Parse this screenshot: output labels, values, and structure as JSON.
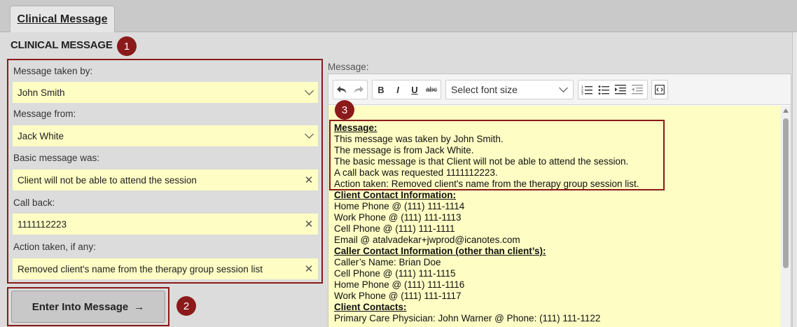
{
  "tab": {
    "label": "Clinical Message"
  },
  "section": {
    "title": "CLINICAL MESSAGE"
  },
  "badges": {
    "one": "1",
    "two": "2",
    "three": "3"
  },
  "form": {
    "taken_by": {
      "label": "Message taken by:",
      "value": "John Smith"
    },
    "from": {
      "label": "Message from:",
      "value": "Jack White"
    },
    "basic": {
      "label": "Basic message was:",
      "value": "Client will not be able to attend the session"
    },
    "callback": {
      "label": "Call back:",
      "value": "1111112223"
    },
    "action": {
      "label": "Action taken, if any:",
      "value": "Removed client's name from the therapy group session list"
    }
  },
  "enter_button": {
    "label": "Enter Into Message",
    "arrow": "→"
  },
  "editor": {
    "label": "Message:",
    "font_size_select": "Select font size",
    "toolbar": {
      "bold": "B",
      "italic": "I",
      "underline": "U",
      "strike": "abc"
    },
    "lines": [
      {
        "text": "Message:",
        "heading": true
      },
      {
        "text": "This message was taken by John Smith."
      },
      {
        "text": "The message is from Jack White."
      },
      {
        "text": "The basic message is that Client will not be able to attend the session."
      },
      {
        "text": "A call back was requested 1111112223."
      },
      {
        "text": "Action taken: Removed client's name from the therapy group session list."
      },
      {
        "text": "Client Contact Information:",
        "heading": true
      },
      {
        "text": "Home Phone @ (111) 111-1114"
      },
      {
        "text": "Work Phone @ (111) 111-1113"
      },
      {
        "text": "Cell Phone @ (111) 111-1111"
      },
      {
        "text": "Email @ atalvadekar+jwprod@icanotes.com"
      },
      {
        "text": "Caller Contact Information (other than client’s):",
        "heading": true
      },
      {
        "text": "Caller’s Name: Brian Doe"
      },
      {
        "text": "Cell Phone @ (111) 111-1115"
      },
      {
        "text": "Home Phone @ (111) 111-1116"
      },
      {
        "text": "Work Phone @ (111) 111-1117"
      },
      {
        "text": "Client Contacts:",
        "heading": true
      },
      {
        "text": "Primary Care Physician: John Warner @ Phone: (111) 111-1122"
      }
    ]
  },
  "colors": {
    "accent": "#8b1a1a",
    "field_bg": "#fdfdc4"
  }
}
